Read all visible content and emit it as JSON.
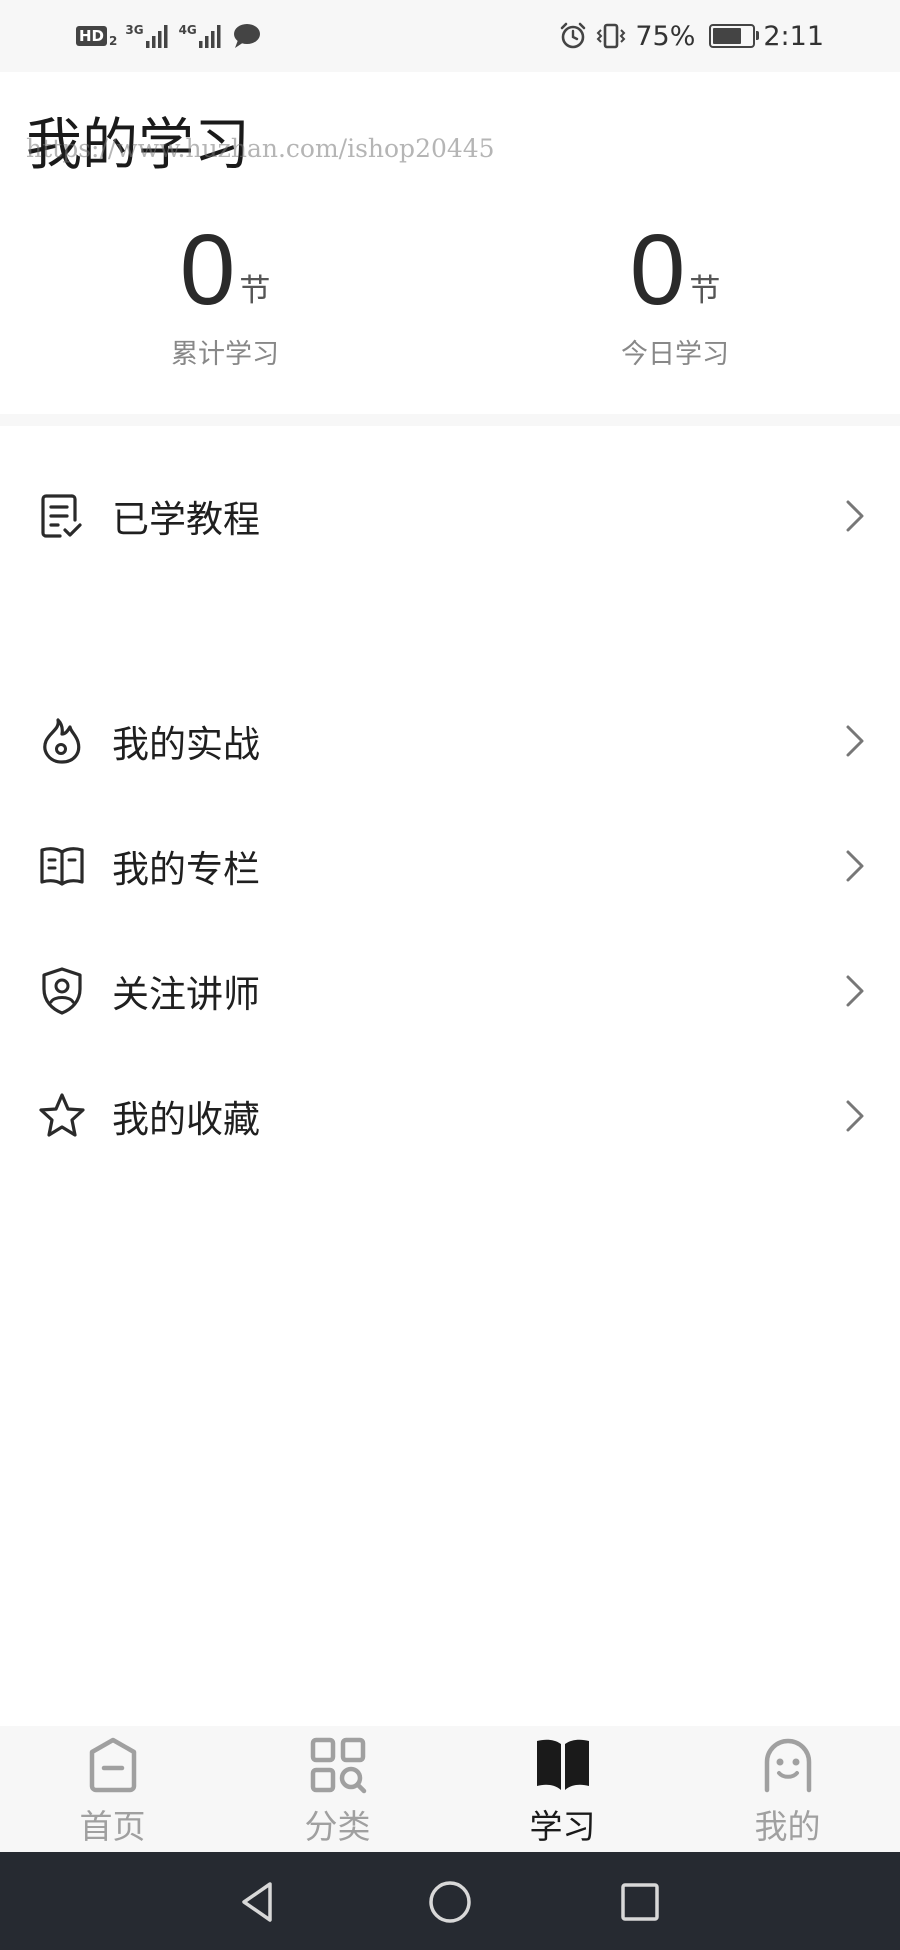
{
  "status_bar": {
    "hd_label": "HD",
    "hd_sub": "2",
    "net1_label": "3G",
    "net2_label": "4G",
    "battery_percent_text": "75%",
    "battery_level": 0.75,
    "time": "2:11"
  },
  "header": {
    "title": "我的学习",
    "watermark": "https://www.huzhan.com/ishop20445"
  },
  "stats": [
    {
      "value": "0",
      "unit": "节",
      "label": "累计学习"
    },
    {
      "value": "0",
      "unit": "节",
      "label": "今日学习"
    }
  ],
  "menu": {
    "learned": {
      "label": "已学教程",
      "icon": "checklist-icon"
    },
    "practice": {
      "label": "我的实战",
      "icon": "flame-icon"
    },
    "columns": {
      "label": "我的专栏",
      "icon": "open-book-icon"
    },
    "teachers": {
      "label": "关注讲师",
      "icon": "teacher-shield-icon"
    },
    "favorites": {
      "label": "我的收藏",
      "icon": "star-icon"
    }
  },
  "tabs": [
    {
      "label": "首页",
      "icon": "home-icon",
      "active": false
    },
    {
      "label": "分类",
      "icon": "category-icon",
      "active": false
    },
    {
      "label": "学习",
      "icon": "book-icon",
      "active": true
    },
    {
      "label": "我的",
      "icon": "profile-icon",
      "active": false
    }
  ],
  "colors": {
    "text_primary": "#1f1f1f",
    "text_secondary": "#888888",
    "tab_inactive": "#a0a0a0",
    "tab_active": "#1a1a1a",
    "nav_bar": "#262a31"
  }
}
